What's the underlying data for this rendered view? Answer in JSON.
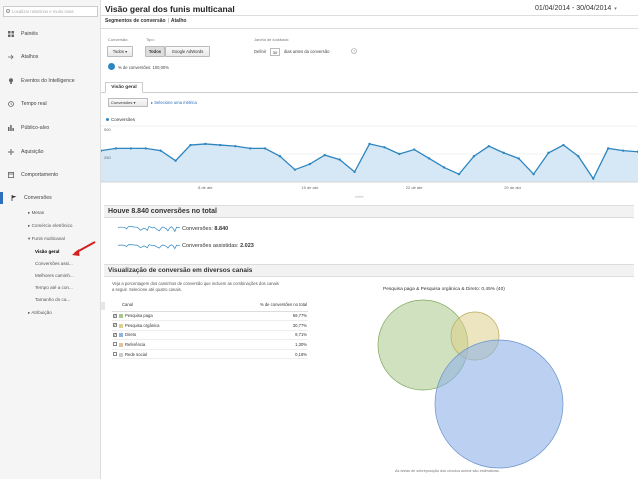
{
  "sidebar": {
    "search_placeholder": "Localizar relatórios e muito mais",
    "items": [
      {
        "label": "Painéis",
        "icon": "dashboard-icon"
      },
      {
        "label": "Atalhos",
        "icon": "shortcut-icon"
      },
      {
        "label": "Eventos do Intelligence",
        "icon": "bulb-icon"
      },
      {
        "label": "Tempo real",
        "icon": "clock-icon"
      },
      {
        "label": "Público-alvo",
        "icon": "people-icon"
      },
      {
        "label": "Aquisição",
        "icon": "acquisition-icon"
      },
      {
        "label": "Comportamento",
        "icon": "behavior-icon"
      },
      {
        "label": "Conversões",
        "icon": "flag-icon"
      }
    ],
    "sub_items": [
      {
        "label": "▸ Metas"
      },
      {
        "label": "▸ Comércio eletrônico"
      },
      {
        "label": "▾ Funis multicanal"
      },
      {
        "label": "Visão geral",
        "selected": true
      },
      {
        "label": "Conversões assi..."
      },
      {
        "label": "Melhores caminh..."
      },
      {
        "label": "Tempo até a con..."
      },
      {
        "label": "Tamanho do ca..."
      },
      {
        "label": "▸ Atribuição"
      }
    ]
  },
  "header": {
    "title": "Visão geral dos funis multicanal",
    "date_range": "01/04/2014 - 30/04/2014",
    "subnav_segments": "Segmentos de conversão",
    "subnav_shortcut": "Atalho"
  },
  "controls": {
    "conversion_label": "Conversão:",
    "conversion_value": "Todos ▾",
    "type_label": "Tipo:",
    "type_all": "Todos",
    "type_adwords": "Google AdWords",
    "lookback_label": "Janela de lookback:",
    "lookback_prefix": "Definir",
    "lookback_value": "30",
    "lookback_suffix": "dias antes da conversão",
    "pct_conversions": "% de conversões: 100,00%"
  },
  "tabs": {
    "overview": "Visão geral"
  },
  "chart_toolbar": {
    "metric": "Conversões ▾",
    "select_metric": "Selecione uma métrica"
  },
  "chart_data": {
    "type": "area",
    "series": [
      {
        "name": "Conversões",
        "color": "#2e86c1",
        "values": [
          280,
          300,
          300,
          300,
          280,
          190,
          330,
          340,
          330,
          320,
          300,
          300,
          230,
          110,
          160,
          240,
          200,
          90,
          340,
          310,
          250,
          290,
          210,
          130,
          70,
          230,
          320,
          260,
          210,
          70,
          260,
          330,
          230,
          30,
          300,
          280,
          270
        ]
      }
    ],
    "x_tick_labels": [
      "8 de abr",
      "15 de abr",
      "22 de abr",
      "29 de abr"
    ],
    "y_tick_labels": [
      "500",
      "250"
    ],
    "ylim": [
      0,
      500
    ]
  },
  "summary": {
    "title": "Houve 8.840 conversões no total",
    "conv_label": "Conversões:",
    "conv_value": "8.840",
    "assisted_label": "Conversões assistidas:",
    "assisted_value": "2.023"
  },
  "channels": {
    "title": "Visualização de conversão em diversos canais",
    "description": "Veja a porcentagem dos caminhos de conversão que incluem as combinações dos canais a seguir. Selecione até quatro canais.",
    "col_channel": "Canal",
    "col_pct": "% de conversões no total",
    "rows": [
      {
        "label": "Pesquisa paga",
        "pct": "59,77%",
        "checked": true,
        "color": "#a9c98a"
      },
      {
        "label": "Pesquisa orgânica",
        "pct": "30,77%",
        "checked": true,
        "color": "#ddd08a"
      },
      {
        "label": "Direto",
        "pct": "9,71%",
        "checked": true,
        "color": "#8fb3e8"
      },
      {
        "label": "Referência",
        "pct": "1,30%",
        "checked": false,
        "color": "#e0c4a0"
      },
      {
        "label": "Rede social",
        "pct": "0,18%",
        "checked": false,
        "color": "#cccccc"
      }
    ],
    "venn_title": "Pesquisa paga & Pesquisa orgânica & Direto: 0,45% (40)",
    "venn_footnote": "As áreas de sobreposição dos círculos acima são estimativas."
  }
}
